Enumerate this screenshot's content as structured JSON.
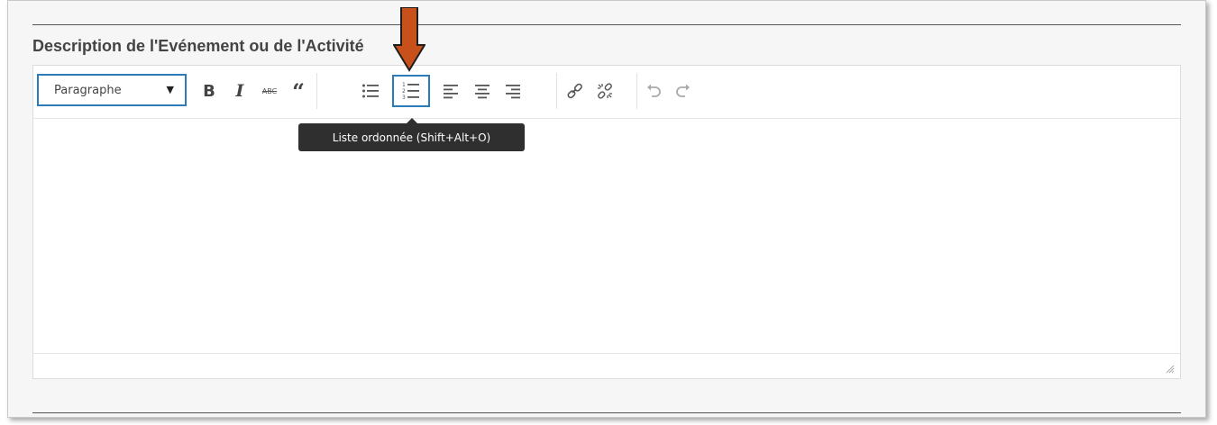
{
  "field": {
    "title": "Description de l'Evénement ou de l'Activité"
  },
  "toolbar": {
    "format_select": {
      "value": "Paragraphe"
    },
    "buttons": [
      {
        "name": "bold",
        "icon": "bold-icon",
        "glyph": "B"
      },
      {
        "name": "italic",
        "icon": "italic-icon",
        "glyph": "I"
      },
      {
        "name": "strikethrough",
        "icon": "strikethrough-icon",
        "glyph": "ABC"
      },
      {
        "name": "blockquote",
        "icon": "blockquote-icon",
        "glyph": "66"
      },
      {
        "name": "bullet-list",
        "icon": "bullet-list-icon"
      },
      {
        "name": "numbered-list",
        "icon": "numbered-list-icon",
        "active": true
      },
      {
        "name": "align-left",
        "icon": "align-left-icon"
      },
      {
        "name": "align-center",
        "icon": "align-center-icon"
      },
      {
        "name": "align-right",
        "icon": "align-right-icon"
      },
      {
        "name": "insert-link",
        "icon": "link-icon"
      },
      {
        "name": "remove-link",
        "icon": "unlink-icon"
      },
      {
        "name": "undo",
        "icon": "undo-icon"
      },
      {
        "name": "redo",
        "icon": "redo-icon"
      }
    ]
  },
  "tooltip": {
    "text": "Liste ordonnée (Shift+Alt+O)"
  },
  "colors": {
    "accent": "#2b7bb9",
    "arrow": "#c8511b",
    "tooltip_bg": "#2f2f2f"
  }
}
